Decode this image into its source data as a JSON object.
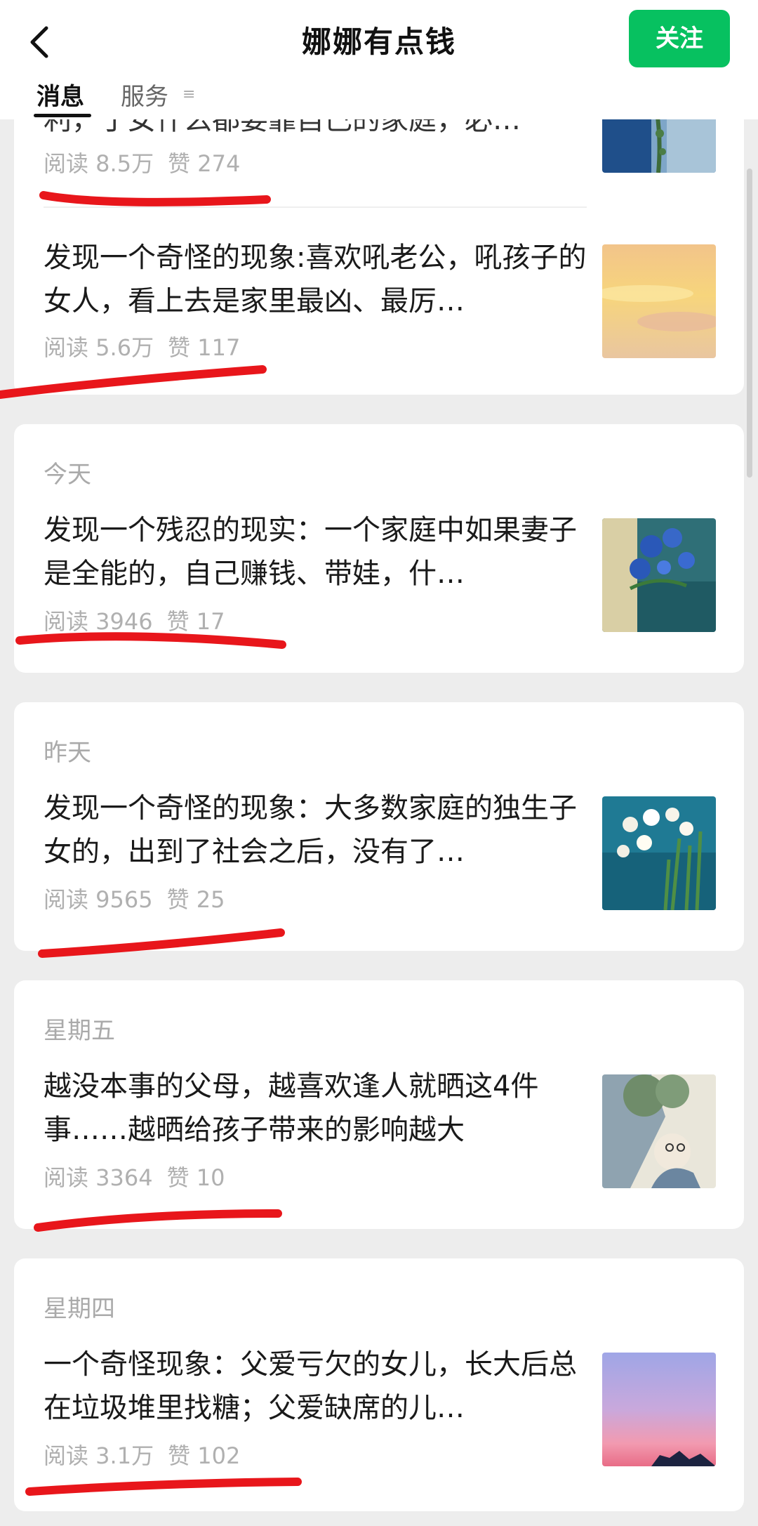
{
  "header": {
    "title": "娜娜有点钱",
    "follow_label": "关注",
    "back_icon": "chevron-left-icon"
  },
  "tabs": {
    "messages": "消息",
    "services": "服务",
    "menu_icon": "≡"
  },
  "articles": [
    {
      "title": "利，丁女什么都要靠自己的家庭，必…",
      "reads": "阅读 8.5万",
      "likes": "赞 274"
    },
    {
      "title": "发现一个奇怪的现象:喜欢吼老公，吼孩子的女人，看上去是家里最凶、最厉…",
      "reads": "阅读 5.6万",
      "likes": "赞 117"
    },
    {
      "day": "今天",
      "title": "发现一个残忍的现实：一个家庭中如果妻子是全能的，自己赚钱、带娃，什…",
      "reads": "阅读 3946",
      "likes": "赞 17"
    },
    {
      "day": "昨天",
      "title": "发现一个奇怪的现象：大多数家庭的独生子女的，出到了社会之后，没有了…",
      "reads": "阅读 9565",
      "likes": "赞 25"
    },
    {
      "day": "星期五",
      "title": "越没本事的父母，越喜欢逢人就晒这4件事……越晒给孩子带来的影响越大",
      "reads": "阅读 3364",
      "likes": "赞 10"
    },
    {
      "day": "星期四",
      "title": "一个奇怪现象：父爱亏欠的女儿，长大后总在垃圾堆里找糖；父爱缺席的儿…",
      "reads": "阅读 3.1万",
      "likes": "赞 102"
    }
  ],
  "colors": {
    "accent": "#07c160",
    "annotation": "#e8161b",
    "background": "#ededed"
  }
}
